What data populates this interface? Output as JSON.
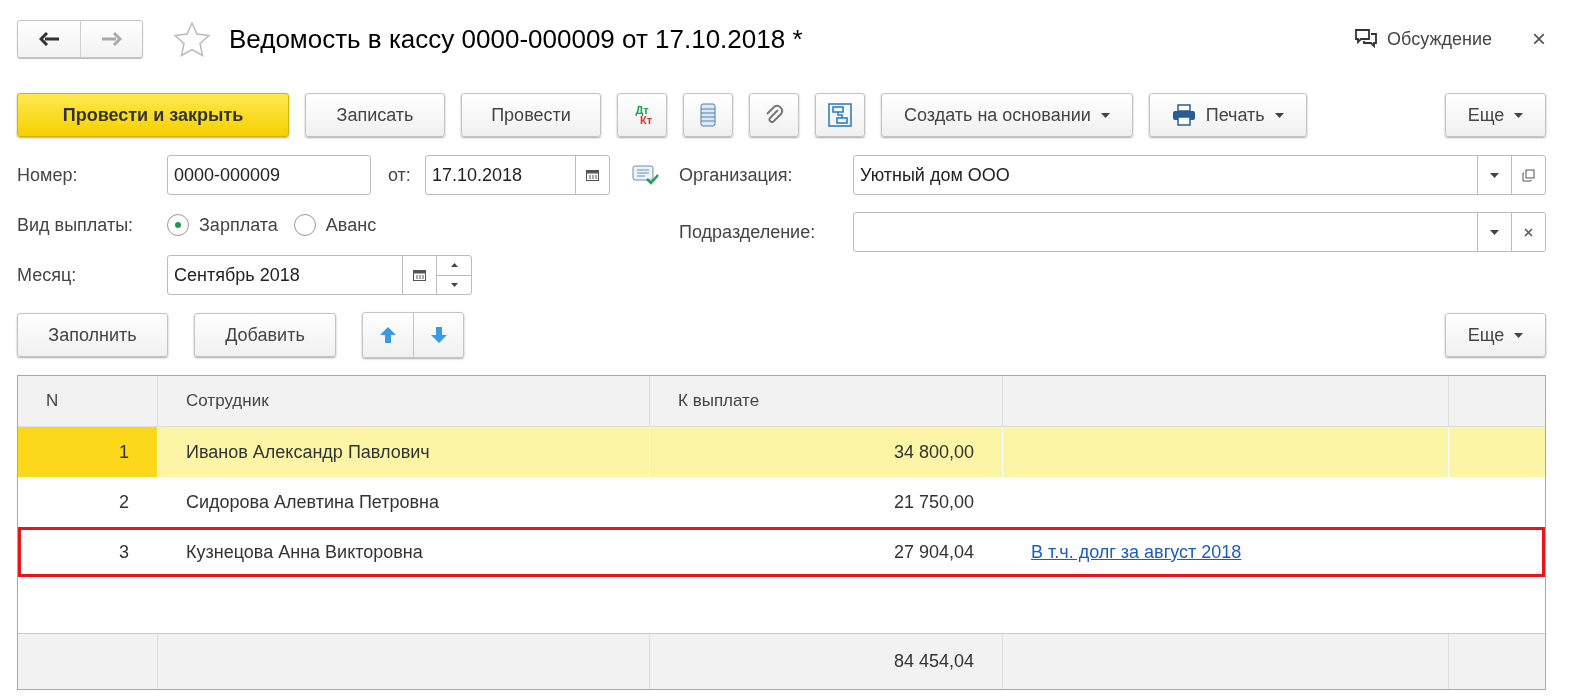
{
  "header": {
    "title": "Ведомость в кассу 0000-000009 от 17.10.2018 *",
    "favorite": false,
    "discussion": "Обсуждение",
    "close": "×"
  },
  "toolbar": {
    "buttons": [
      {
        "kind": "primary",
        "label": "Провести и закрыть"
      },
      {
        "kind": "text",
        "label": "Записать"
      },
      {
        "kind": "text",
        "label": "Провести"
      },
      {
        "kind": "dtkt",
        "dt": "Дт",
        "kt": "Кт"
      },
      {
        "kind": "stack"
      },
      {
        "kind": "clip"
      },
      {
        "kind": "structure"
      },
      {
        "kind": "menu",
        "label": "Создать на основании"
      },
      {
        "kind": "print",
        "label": "Печать"
      }
    ],
    "more": "Еще"
  },
  "form": {
    "number": {
      "label": "Номер:",
      "value": "0000-000009"
    },
    "date": {
      "label": "от:",
      "value": "17.10.2018"
    },
    "organization": {
      "label": "Организация:",
      "value": "Уютный дом ООО"
    },
    "payment_type": {
      "label": "Вид выплаты:",
      "options": [
        {
          "label": "Зарплата",
          "selected": true
        },
        {
          "label": "Аванс",
          "selected": false
        }
      ]
    },
    "subdivision": {
      "label": "Подразделение:"
    },
    "month": {
      "label": "Месяц:",
      "value": "Сентябрь 2018"
    }
  },
  "table_toolbar": {
    "fill": "Заполнить",
    "add": "Добавить",
    "more": "Еще"
  },
  "table": {
    "columns": [
      "N",
      "Сотрудник",
      "К выплате"
    ],
    "rows": [
      {
        "n": "1",
        "employee": "Иванов Александр Павлович",
        "amount": "34 800,00",
        "selected": true,
        "highlighted": false
      },
      {
        "n": "2",
        "employee": "Сидорова Алевтина Петровна",
        "amount": "21 750,00",
        "selected": false,
        "highlighted": false
      },
      {
        "n": "3",
        "employee": "Кузнецова Анна Викторовна",
        "amount": "27 904,04",
        "note": "В т.ч. долг за август 2018",
        "selected": false,
        "highlighted": true
      }
    ],
    "total": "84 454,04"
  }
}
